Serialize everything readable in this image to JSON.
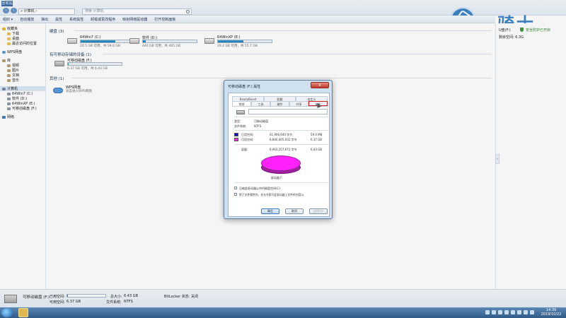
{
  "titlebar": {
    "recycle_label": "回收站",
    "address": "» 计算机 ›",
    "search_placeholder": "搜索 计算机"
  },
  "logo": {
    "text": "云骑士"
  },
  "toolbar": {
    "items": [
      "组织 ▾",
      "自动播放",
      "弹出",
      "属性",
      "系统属性",
      "卸载或更改程序",
      "映射网络驱动器",
      "打开控制面板"
    ]
  },
  "leftnav": {
    "favorites": {
      "label": "收藏夹",
      "items": [
        "下载",
        "桌面",
        "最近访问的位置"
      ]
    },
    "cloud": "WPS网盘",
    "libraries": {
      "label": "库",
      "items": [
        "视频",
        "图片",
        "文档",
        "音乐"
      ]
    },
    "computer": {
      "label": "计算机",
      "items": [
        "64Win7 (C:)",
        "软件 (D:)",
        "64WinXP (E:)",
        "可移动磁盘 (F:)"
      ]
    },
    "network": "网络"
  },
  "main": {
    "hdd_section": "硬盘 (3)",
    "removable_section": "有可移动存储的设备 (1)",
    "other_section": "其他 (1)",
    "drives": [
      {
        "name": "64Win7 (C:)",
        "free": "20.5 GB 可用，共 59.0 GB",
        "used_fraction": 0.65
      },
      {
        "name": "软件 (D:)",
        "free": "440 GB 可用，共 465 GB",
        "used_fraction": 0.05
      },
      {
        "name": "64WinXP (E:)",
        "free": "29.2 GB 可用，共 55.7 GB",
        "used_fraction": 0.48
      }
    ],
    "removable": {
      "name": "可移动磁盘 (F:)",
      "free": "6.37 GB 可用，共 6.43 GB",
      "used_fraction": 0.01
    },
    "other": {
      "name": "WPS网盘",
      "desc": "双击进入WPS网盘"
    }
  },
  "rightpane": {
    "drive_label": "U盘(F:)",
    "protect": "安全防护已开启",
    "space": "剩余空间: 6.3G"
  },
  "details": {
    "name": "可移动磁盘 (F:)",
    "used_label": "已用空间:",
    "free_label": "可用空间:",
    "free_value": "6.37 GB",
    "total_label": "总大小:",
    "total_value": "6.43 GB",
    "fs_label": "文件系统:",
    "fs_value": "NTFS",
    "bitlocker_label": "BitLocker 状态:",
    "bitlocker_value": "关闭",
    "used_fraction": 0.01
  },
  "taskbar": {
    "time": "14:39",
    "date": "2019/10/22"
  },
  "dialog": {
    "title": "可移动磁盘 (F:) 属性",
    "close": "x",
    "tabs_top": [
      "ReadyBoost",
      "配额",
      "自定义"
    ],
    "tabs_bottom": [
      "常规",
      "工具",
      "硬件",
      "共享",
      "安全"
    ],
    "type_label": "类型:",
    "type_value": "可移动磁盘",
    "fs_label": "文件系统:",
    "fs_value": "NTFS",
    "used_label": "已用空间:",
    "used_bytes": "61,906,640 字节",
    "used_size": "59.0 MB",
    "free_label": "可用空间:",
    "free_bytes": "6,840,405,032 字节",
    "free_size": "6.37 GB",
    "capacity_label": "容量:",
    "capacity_bytes": "6,903,257,672 字节",
    "capacity_size": "6.43 GB",
    "drive_caption": "驱动器 F:",
    "compress_label": "压缩此驱动器以节约磁盘空间(C)",
    "index_label": "除了文件属性外，还允许索引此驱动器上文件的内容(I)",
    "ok": "确定",
    "cancel": "取消",
    "apply": "应用(A)",
    "used_color": "#1010c8",
    "free_color": "#ff22ff"
  }
}
